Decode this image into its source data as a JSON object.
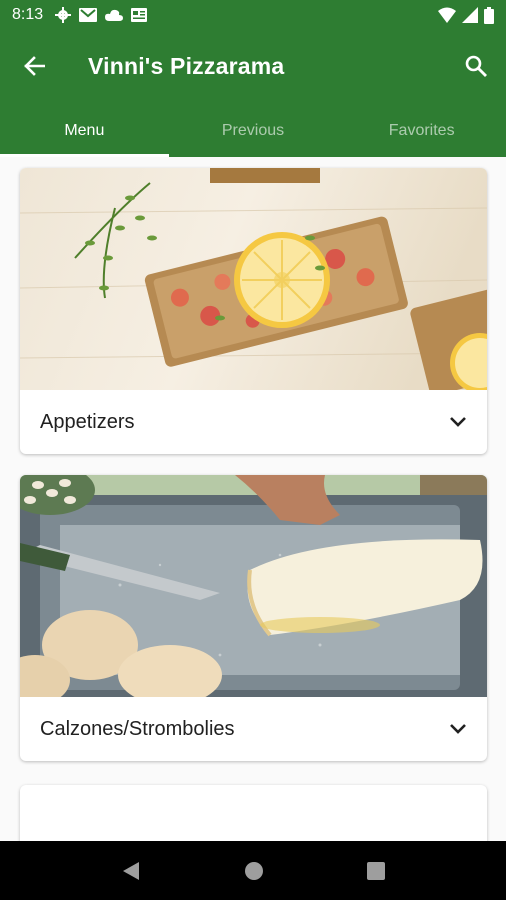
{
  "status_bar": {
    "time": "8:13"
  },
  "app_bar": {
    "title": "Vinni's Pizzarama"
  },
  "tabs": [
    {
      "label": "Menu",
      "active": true
    },
    {
      "label": "Previous",
      "active": false
    },
    {
      "label": "Favorites",
      "active": false
    }
  ],
  "categories": [
    {
      "label": "Appetizers",
      "image": "bruschetta-photo"
    },
    {
      "label": "Calzones/Strombolies",
      "image": "calzone-photo"
    }
  ],
  "colors": {
    "primary": "#2e7d32",
    "text": "#212121"
  }
}
